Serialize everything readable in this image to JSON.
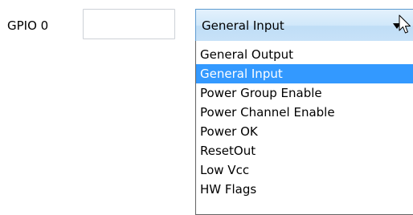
{
  "gpio": {
    "label": "GPIO 0",
    "value": ""
  },
  "combo": {
    "selected_value": "General Input",
    "expanded": true
  },
  "dropdown": {
    "options": [
      "General Output",
      "General Input",
      "Power Group Enable",
      "Power Channel Enable",
      "Power OK",
      "ResetOut",
      "Low Vcc",
      "HW Flags"
    ],
    "selected_index": 1
  },
  "colors": {
    "selection_highlight": "#3399ff",
    "combo_border": "#5e9bd0",
    "field_border": "#cdd1d7"
  },
  "icons": {
    "combo_arrow": "triangle-down",
    "cursor": "mouse-pointer"
  }
}
